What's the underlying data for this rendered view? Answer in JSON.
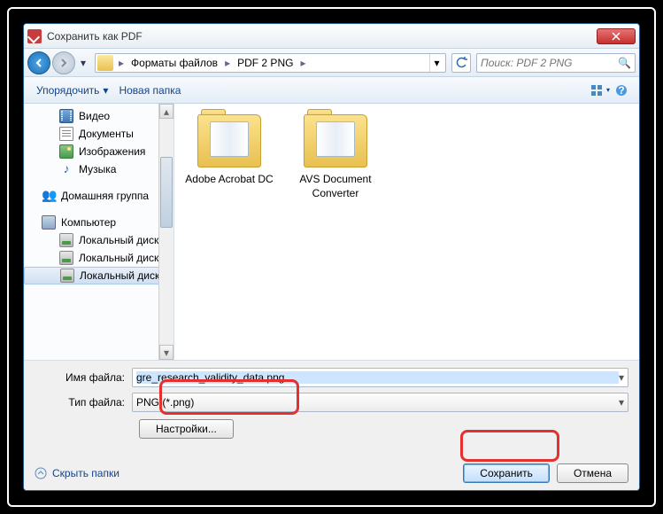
{
  "title": "Сохранить как PDF",
  "breadcrumbs": [
    "Форматы файлов",
    "PDF 2 PNG"
  ],
  "search_placeholder": "Поиск: PDF 2 PNG",
  "toolbar": {
    "organize": "Упорядочить",
    "new_folder": "Новая папка"
  },
  "sidebar": {
    "video": "Видео",
    "documents": "Документы",
    "images": "Изображения",
    "music": "Музыка",
    "homegroup": "Домашняя группа",
    "computer": "Компьютер",
    "disk1": "Локальный диск",
    "disk2": "Локальный диск",
    "disk3": "Локальный диск"
  },
  "folders": [
    {
      "name": "Adobe Acrobat DC"
    },
    {
      "name": "AVS Document Converter"
    }
  ],
  "filename_label": "Имя файла:",
  "filename_value": "gre_research_validity_data.png",
  "filetype_label": "Тип файла:",
  "filetype_value": "PNG (*.png)",
  "settings_btn": "Настройки...",
  "hide_folders": "Скрыть папки",
  "save_btn": "Сохранить",
  "cancel_btn": "Отмена"
}
